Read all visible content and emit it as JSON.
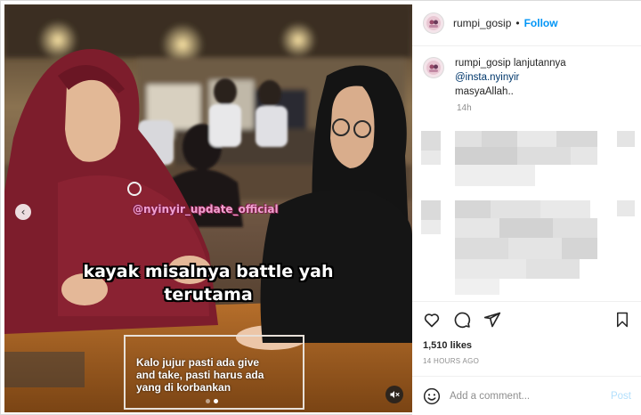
{
  "media": {
    "watermark": "@nyinyir_update_official",
    "caption_line1": "kayak misalnya battle yah",
    "caption_line2": "terutama",
    "subtitle": "Kalo jujur pasti ada give\nand take, pasti harus ada\nyang di korbankan",
    "prev_glyph": "‹",
    "carousel_dots": 2,
    "carousel_active": 1
  },
  "header": {
    "username": "rumpi_gosip",
    "separator": "•",
    "follow_label": "Follow"
  },
  "caption_comment": {
    "username": "rumpi_gosip",
    "text_before": " lanjutannya",
    "mention": "@insta.nyinyir",
    "text_after": "masyaAllah..",
    "time": "14h"
  },
  "actions": {
    "likes": "1,510 likes",
    "posted": "14 HOURS AGO"
  },
  "add_comment": {
    "placeholder": "Add a comment...",
    "post_label": "Post"
  },
  "icons": [
    "heart-icon",
    "comment-icon",
    "share-icon",
    "bookmark-icon",
    "emoji-icon",
    "mute-icon",
    "chevron-left-icon"
  ],
  "colors": {
    "accent": "#0095f6",
    "mention": "#00376b",
    "muted": "#8e8e8e"
  }
}
